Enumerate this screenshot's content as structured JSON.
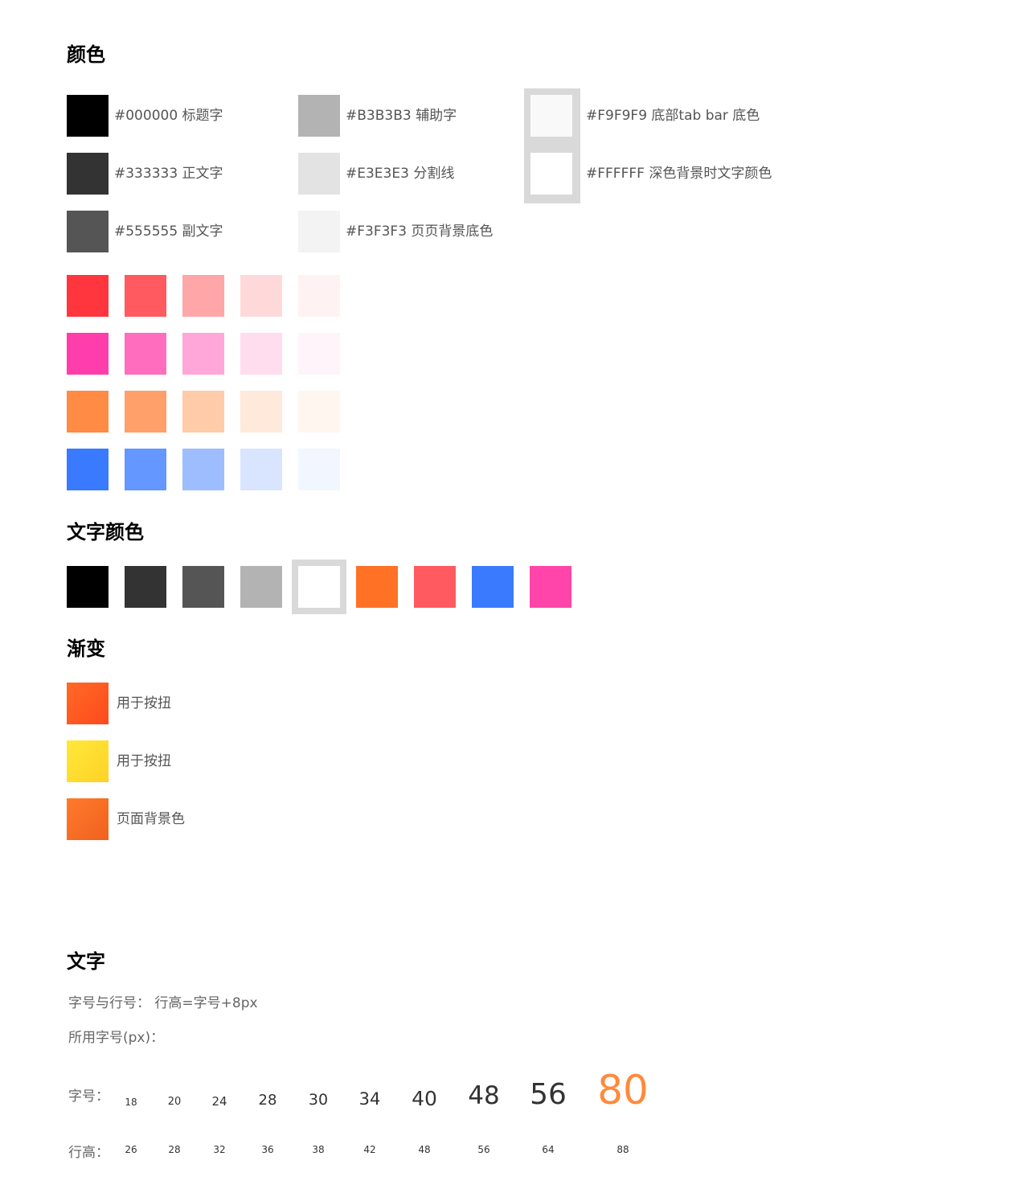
{
  "colors_section": {
    "title": "颜色",
    "neutral_col1": [
      {
        "color": "#000000",
        "label": "#000000 标题字"
      },
      {
        "color": "#333333",
        "label": "#333333 正文字"
      },
      {
        "color": "#555555",
        "label": "#555555 副文字"
      }
    ],
    "neutral_col2": [
      {
        "color": "#B3B3B3",
        "label": "#B3B3B3 辅助字"
      },
      {
        "color": "#E3E3E3",
        "label": "#E3E3E3 分割线"
      },
      {
        "color": "#F3F3F3",
        "label": "#F3F3F3 页页背景底色"
      }
    ],
    "neutral_col3": [
      {
        "color": "#F9F9F9",
        "label": "#F9F9F9 底部tab bar 底色"
      },
      {
        "color": "#FFFFFF",
        "label": "#FFFFFF 深色背景时文字颜色"
      }
    ],
    "palette_rows": [
      [
        "#FF363E",
        "#FF5A60",
        "#FFA6A9",
        "#FFD9DA",
        "#FFF2F3"
      ],
      [
        "#FF3DAB",
        "#FF6DBE",
        "#FFA7D8",
        "#FFDDEF",
        "#FFF4FA"
      ],
      [
        "#FF8B45",
        "#FFA06A",
        "#FFCBA9",
        "#FFE9DB",
        "#FFF6F0"
      ],
      [
        "#3A7AFE",
        "#6497FF",
        "#9DBDFF",
        "#D9E5FF",
        "#F1F6FF"
      ]
    ]
  },
  "text_colors_section": {
    "title": "文字颜色",
    "colors": [
      "#000000",
      "#333333",
      "#555555",
      "#B3B3B3",
      "#FFFFFF",
      "#FF7124",
      "#FF5A5F",
      "#3A7AFE",
      "#FF45A9"
    ]
  },
  "gradient_section": {
    "title": "渐变",
    "items": [
      {
        "from": "#FF6A25",
        "to": "#FF4A1E",
        "label": "用于按扭"
      },
      {
        "from": "#FFE83A",
        "to": "#FFD226",
        "label": "用于按扭"
      },
      {
        "from": "#FF7A2C",
        "to": "#F0621E",
        "label": "页面背景色"
      }
    ]
  },
  "text_section": {
    "title": "文字",
    "line1": "字号与行号：  行高=字号+8px",
    "line2": "所用字号(px)：",
    "size_label": "字号：",
    "height_label": "行高：",
    "sizes": [
      "18",
      "20",
      "24",
      "28",
      "30",
      "34",
      "40",
      "48",
      "56",
      "80"
    ],
    "heights": [
      "26",
      "28",
      "32",
      "36",
      "38",
      "42",
      "48",
      "56",
      "64",
      "88"
    ],
    "highlight_color": "#FF8A3C"
  }
}
